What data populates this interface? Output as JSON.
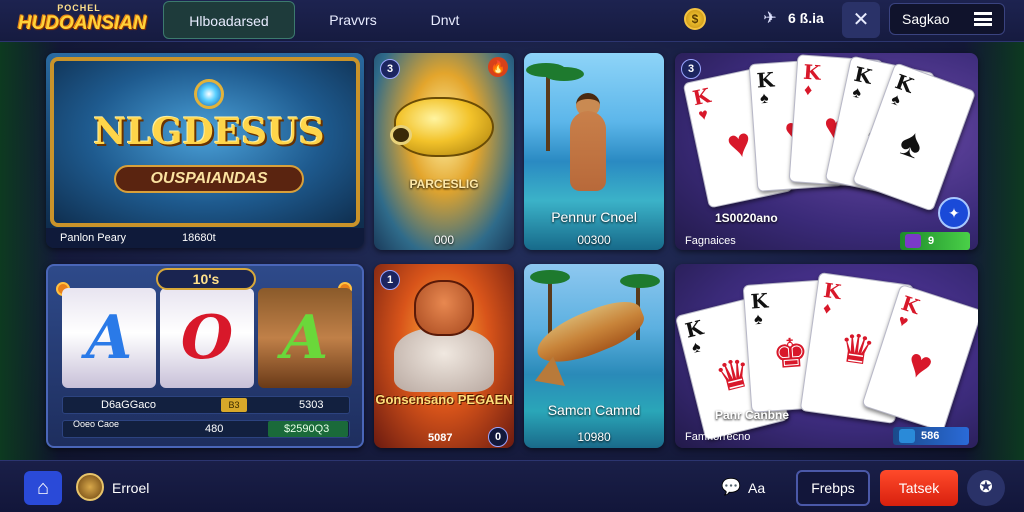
{
  "header": {
    "logo_top": "POCHEL",
    "logo_main": "HUDOANSIAN",
    "tabs": [
      {
        "label": "Hlboadarsed",
        "active": true
      },
      {
        "label": "Pravvrs",
        "active": false
      },
      {
        "label": "Dnvt",
        "active": false
      }
    ],
    "balance": "6 ß.ia",
    "signup_label": "Sagkao"
  },
  "cards": {
    "featured": {
      "title": "NLGDESUS",
      "subtitle": "OUSPAIANDAS",
      "footer_left": "Panlon Peary",
      "footer_right": "18680t"
    },
    "fish": {
      "badge": "3",
      "title": "PARCESLIG",
      "amount": "000"
    },
    "beach": {
      "title": "Pennur Cnoel",
      "amount": "00300"
    },
    "cards1": {
      "badge": "3",
      "amount": "1S0020ano",
      "provider": "Fagnaices",
      "pill": "9"
    },
    "slots": {
      "header": "10's",
      "reels": [
        "A",
        "O",
        "A"
      ],
      "row1": {
        "a": "D6aGGaco",
        "b": "B3",
        "c": "5303"
      },
      "row2": {
        "a": "Ooeo Caoe",
        "b": "480",
        "c": "$2590Q3"
      }
    },
    "monster": {
      "badge": "1",
      "title": "Gonsensano PEGAEN",
      "amount": "5087",
      "num": "0"
    },
    "fish2": {
      "title": "Samcn Camnd",
      "amount": "10980"
    },
    "cards2": {
      "amount": "Panr Canbne",
      "provider": "Famnorrecno",
      "pill": "586"
    }
  },
  "footer": {
    "user_name": "Erroel",
    "chat_label": "Aa",
    "outline_button": "Frebps",
    "primary_button": "Tatsek"
  },
  "colors": {
    "accent_primary": "#d8200e",
    "accent_blue": "#2a4ad8",
    "background": "#151a3c",
    "gold": "#ffd23a"
  }
}
